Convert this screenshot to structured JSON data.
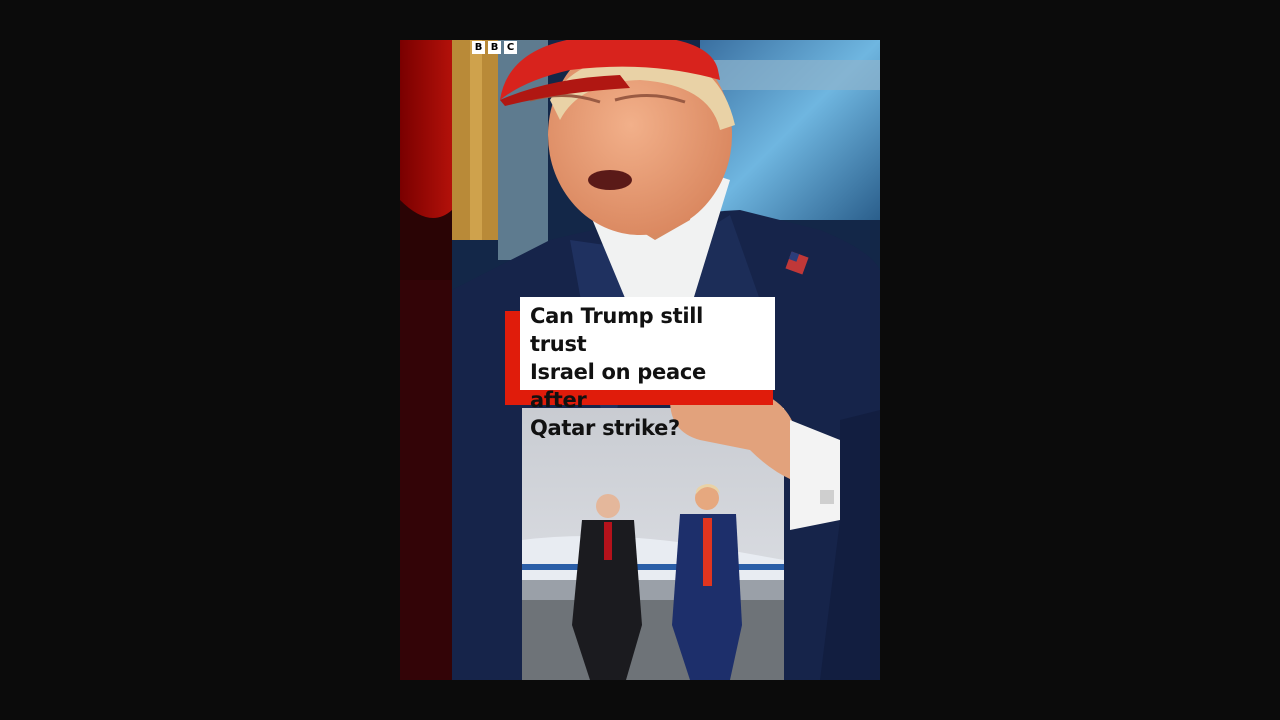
{
  "logo": {
    "letters": [
      "B",
      "B",
      "C"
    ]
  },
  "headline": {
    "text": "Can Trump still trust\nIsrael on peace after\nQatar strike?"
  },
  "colors": {
    "accent_red": "#e01c0b",
    "background": "#0b0b0b",
    "caption_bg": "#ffffff"
  }
}
